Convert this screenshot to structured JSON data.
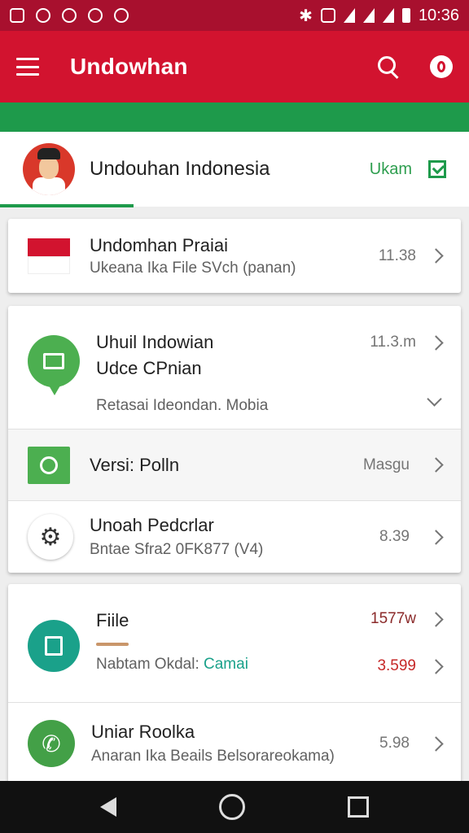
{
  "status_bar": {
    "time": "10:36"
  },
  "toolbar": {
    "title": "Undowhan"
  },
  "header": {
    "title": "Undouhan Indonesia",
    "action": "Ukam"
  },
  "items": [
    {
      "title": "Undomhan Praiai",
      "subtitle": "Ukeana Ika File SVch (panan)",
      "meta": "11.38",
      "icon": "indonesia-flag-icon"
    },
    {
      "title_line1": "Uhuil Indowian",
      "title_line2": "Udce CPnian",
      "subtitle": "Retasai Ideondan. Mobia",
      "meta": "11.3.m",
      "icon": "chat-bubble-icon"
    },
    {
      "title": "Versi: Polln",
      "meta": "Masgu",
      "icon": "green-square-icon"
    },
    {
      "title": "Unoah Pedcrlar",
      "subtitle": "Bntae Sfra2 0FK877 (V4)",
      "meta": "8.39",
      "icon": "gear-icon"
    },
    {
      "title": "Fiile",
      "subtitle_prefix": "Nabtam Okdal:",
      "subtitle_highlight": "Camai",
      "meta": "1577w",
      "meta2": "3.599",
      "icon": "document-icon"
    },
    {
      "title": "Uniar Roolka",
      "subtitle": "Anaran Ika Beails Belsorareokama)",
      "meta": "5.98",
      "icon": "phone-icon"
    }
  ],
  "colors": {
    "primary": "#d2132f",
    "status": "#a8102e",
    "accent_green": "#1e9a4b",
    "teal": "#1aa18a"
  }
}
